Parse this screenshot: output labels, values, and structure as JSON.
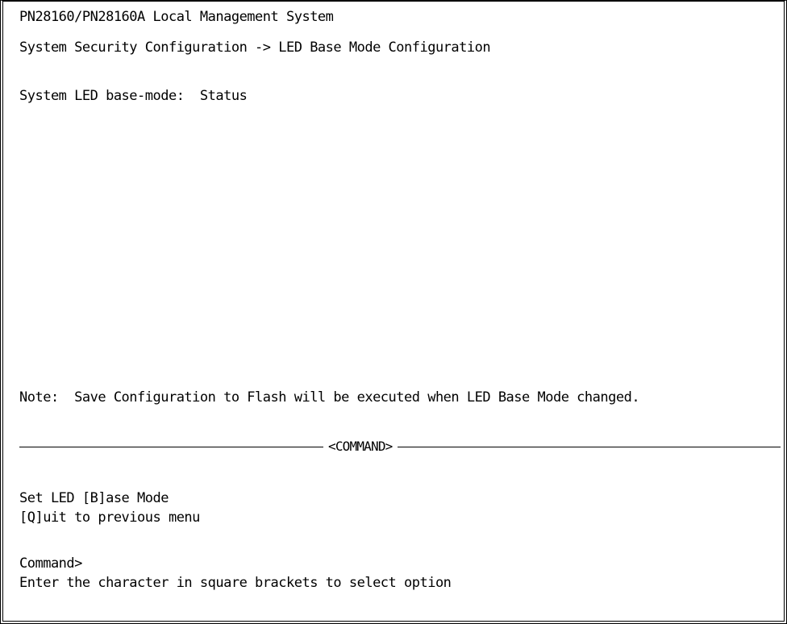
{
  "header": {
    "title": "PN28160/PN28160A Local Management System",
    "breadcrumb": "System Security Configuration -> LED Base Mode Configuration"
  },
  "status": {
    "label": "System LED base-mode:",
    "value": "Status"
  },
  "note": "Note:  Save Configuration to Flash will be executed when LED Base Mode changed.",
  "command_section": {
    "divider_label": "<COMMAND>",
    "options": [
      "Set LED [B]ase Mode",
      "[Q]uit to previous menu"
    ],
    "prompt": "Command>",
    "help": "Enter the character in square brackets to select option"
  }
}
